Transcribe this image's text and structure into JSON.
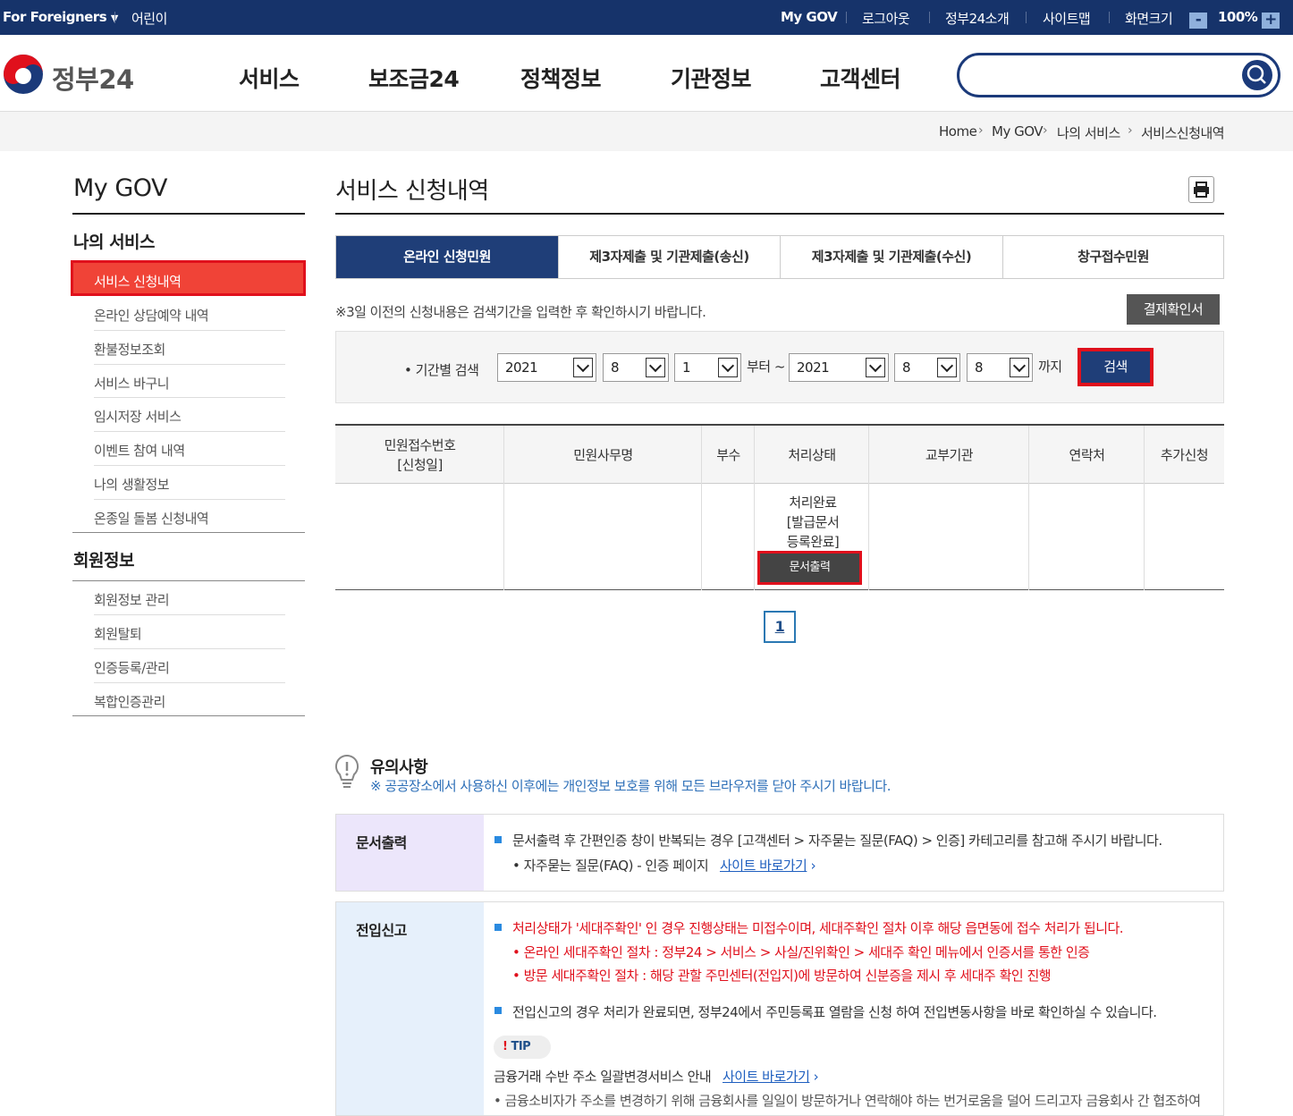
{
  "topbar": {
    "foreigners": "For Foreigners",
    "kids": "어린이",
    "mygov": "My GOV",
    "logout": "로그아웃",
    "about": "정부24소개",
    "sitemap": "사이트맵",
    "screen_size": "화면크기",
    "zoom_minus": "-",
    "zoom": "100%",
    "zoom_plus": "+"
  },
  "header": {
    "logo_text": "정부24",
    "nav": [
      "서비스",
      "보조금24",
      "정책정보",
      "기관정보",
      "고객센터"
    ],
    "search_placeholder": ""
  },
  "breadcrumb": [
    "Home",
    "My GOV",
    "나의 서비스",
    "서비스신청내역"
  ],
  "sidebar": {
    "title": "My GOV",
    "section1": "나의 서비스",
    "items1": [
      "서비스 신청내역",
      "온라인 상담예약 내역",
      "환불정보조회",
      "서비스 바구니",
      "임시저장 서비스",
      "이벤트 참여 내역",
      "나의 생활정보",
      "온종일 돌봄 신청내역"
    ],
    "section2": "회원정보",
    "items2": [
      "회원정보 관리",
      "회원탈퇴",
      "인증등록/관리",
      "복합인증관리"
    ]
  },
  "main": {
    "title": "서비스 신청내역",
    "tabs": [
      "온라인 신청민원",
      "제3자제출 및 기관제출(송신)",
      "제3자제출 및 기관제출(수신)",
      "창구접수민원"
    ],
    "notice": "※3일 이전의 신청내용은 검색기간을 입력한 후 확인하시기 바랍니다.",
    "pay_button": "결제확인서",
    "search": {
      "label": "• 기간별 검색",
      "from_year": "2021",
      "from_month": "8",
      "from_day": "1",
      "from_label": "부터 ~",
      "to_year": "2021",
      "to_month": "8",
      "to_day": "8",
      "to_label": "까지",
      "button": "검색"
    },
    "table": {
      "headers": [
        "민원접수번호\n[신청일]",
        "민원사무명",
        "부수",
        "처리상태",
        "교부기관",
        "연락처",
        "추가신청"
      ],
      "status": "처리완료\n[발급문서\n등록완료]",
      "doc_button": "문서출력"
    },
    "page": "1"
  },
  "caution": {
    "title": "유의사항",
    "text": "※ 공공장소에서 사용하신 이후에는 개인정보 보호를 위해 모든 브라우저를 닫아 주시기 바랍니다."
  },
  "box1": {
    "label": "문서출력",
    "line1": "문서출력 후 간편인증 창이 반복되는 경우 [고객센터 > 자주묻는 질문(FAQ) > 인증] 카테고리를 참고해 주시기 바랍니다.",
    "line2": "자주묻는 질문(FAQ) - 인증 페이지",
    "link": "사이트 바로가기"
  },
  "box2": {
    "label": "전입신고",
    "line1": "처리상태가 '세대주확인' 인 경우 진행상태는 미접수이며, 세대주확인 절차 이후 해당 읍면동에 접수 처리가 됩니다.",
    "line2": "온라인 세대주확인 절차 : 정부24 > 서비스 > 사실/진위확인 > 세대주 확인 메뉴에서 인증서를 통한 인증",
    "line3": "방문 세대주확인 절차 : 해당 관할 주민센터(전입지)에 방문하여 신분증을 제시 후 세대주 확인 진행",
    "line4": "전입신고의 경우 처리가 완료되면, 정부24에서 주민등록표 열람을 신청 하여 전입변동사항을 바로 확인하실 수 있습니다.",
    "tip": "TIP",
    "tip_text": "금융거래 수반 주소 일괄변경서비스 안내",
    "tip_link": "사이트 바로가기",
    "line5": "금융소비자가 주소를 변경하기 위해 금융회사를 일일이 방문하거나 연락해야 하는 번거로움을 덜어 드리고자 금융회사 간 협조하여"
  }
}
